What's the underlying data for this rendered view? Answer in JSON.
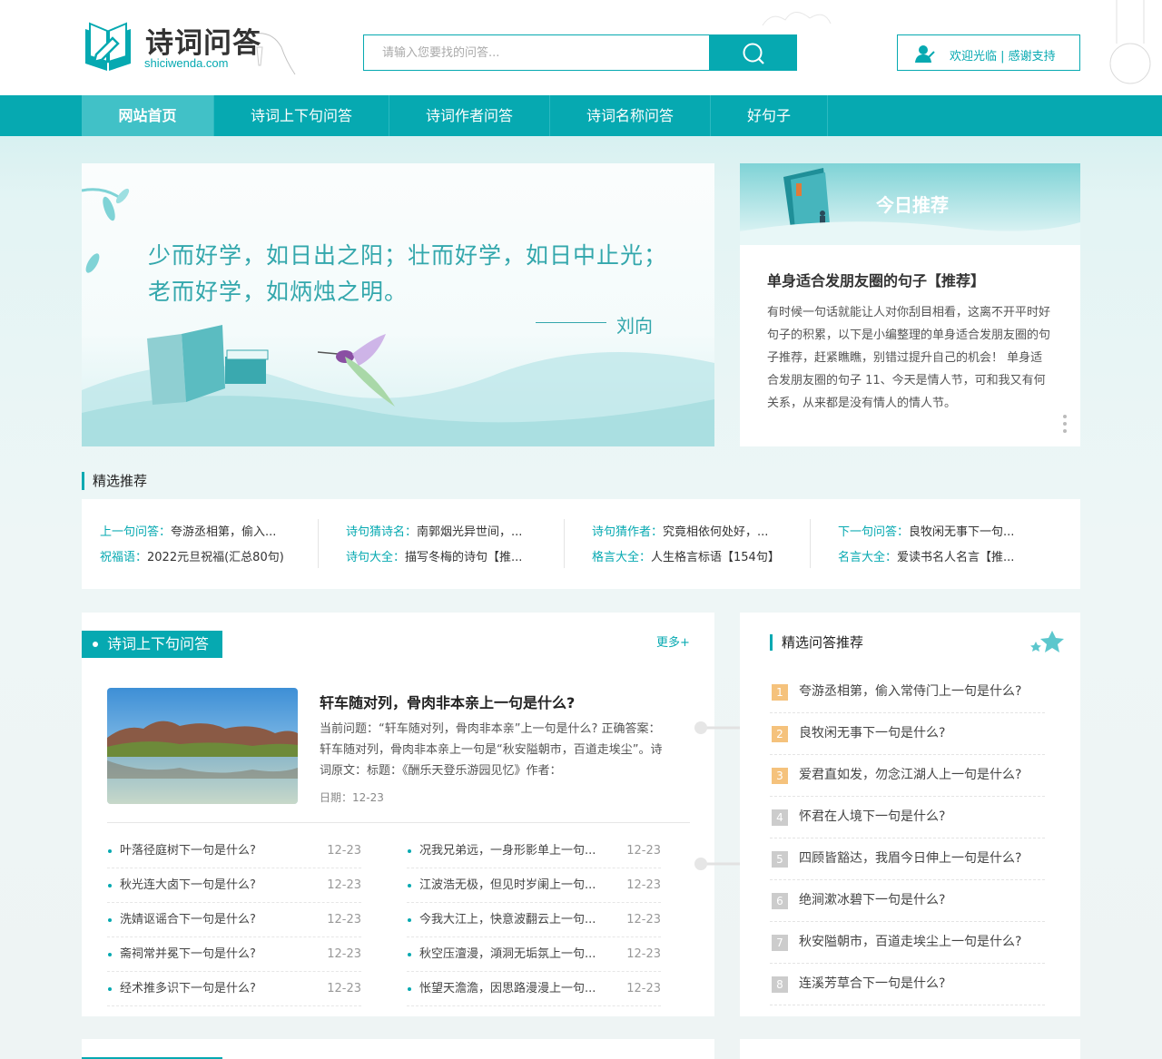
{
  "header": {
    "logo_title": "诗词问答",
    "logo_sub": "shiciwenda.com",
    "search_placeholder": "请输入您要找的问答...",
    "welcome": "欢迎光临 | 感谢支持"
  },
  "nav": [
    "网站首页",
    "诗词上下句问答",
    "诗词作者问答",
    "诗词名称问答",
    "好句子"
  ],
  "banner": {
    "quote": "少而好学，如日出之阳；壮而好学，如日中止光；老而好学，如炳烛之明。",
    "author": "刘向"
  },
  "today": {
    "label": "今日推荐",
    "title": "单身适合发朋友圈的句子【推荐】",
    "desc": "有时候一句话就能让人对你刮目相看，这离不开平时好句子的积累，以下是小编整理的单身适合发朋友圈的句子推荐，赶紧瞧瞧，别错过提升自己的机会！ 单身适合发朋友圈的句子 11、今天是情人节，可和我又有何关系，从来都是没有情人的情人节。"
  },
  "featured": {
    "title": "精选推荐",
    "columns": [
      [
        {
          "cat": "上一句问答：",
          "text": "夸游丞相第，偷入..."
        },
        {
          "cat": "祝福语：",
          "text": "2022元旦祝福(汇总80句)"
        }
      ],
      [
        {
          "cat": "诗句猜诗名：",
          "text": "南郭烟光异世间，..."
        },
        {
          "cat": "诗句大全：",
          "text": "描写冬梅的诗句【推..."
        }
      ],
      [
        {
          "cat": "诗句猜作者：",
          "text": "究竟相依何处好，..."
        },
        {
          "cat": "格言大全：",
          "text": "人生格言标语【154句】"
        }
      ],
      [
        {
          "cat": "下一句问答：",
          "text": "良牧闲无事下一句..."
        },
        {
          "cat": "名言大全：",
          "text": "爱读书名人名言【推..."
        }
      ]
    ]
  },
  "qa": {
    "tab": "诗词上下句问答",
    "more": "更多+",
    "head": "轩车随对列，骨肉非本亲上一句是什么?",
    "body": "当前问题：“轩车随对列，骨肉非本亲”上一句是什么? 正确答案：轩车随对列，骨肉非本亲上一句是“秋安隘朝市，百道走埃尘”。诗词原文：标题：《酬乐天登乐游园见忆》作者：",
    "date": "日期：12-23",
    "left": [
      {
        "t": "叶落径庭树下一句是什么?",
        "d": "12-23"
      },
      {
        "t": "秋光连大卤下一句是什么?",
        "d": "12-23"
      },
      {
        "t": "洗婧讴谣合下一句是什么?",
        "d": "12-23"
      },
      {
        "t": "斋祠常并冕下一句是什么?",
        "d": "12-23"
      },
      {
        "t": "经术推多识下一句是什么?",
        "d": "12-23"
      }
    ],
    "right": [
      {
        "t": "况我兄弟远，一身形影单上一句...",
        "d": "12-23"
      },
      {
        "t": "江波浩无极，但见时岁阑上一句...",
        "d": "12-23"
      },
      {
        "t": "今我大江上，快意波翻云上一句...",
        "d": "12-23"
      },
      {
        "t": "秋空压澶漫，澒洞无垢氛上一句...",
        "d": "12-23"
      },
      {
        "t": "怅望天澹澹，因思路漫漫上一句...",
        "d": "12-23"
      }
    ]
  },
  "side": {
    "title": "精选问答推荐",
    "items": [
      "夸游丞相第，偷入常侍门上一句是什么?",
      "良牧闲无事下一句是什么?",
      "爱君直如发，勿念江湖人上一句是什么?",
      "怀君在人境下一句是什么?",
      "四顾皆豁达，我眉今日伸上一句是什么?",
      "绝涧漱冰碧下一句是什么?",
      "秋安隘朝市，百道走埃尘上一句是什么?",
      "连溪芳草合下一句是什么?"
    ]
  },
  "colors": {
    "accent": "#06a9b1",
    "hot_number": "#f5c27c"
  }
}
